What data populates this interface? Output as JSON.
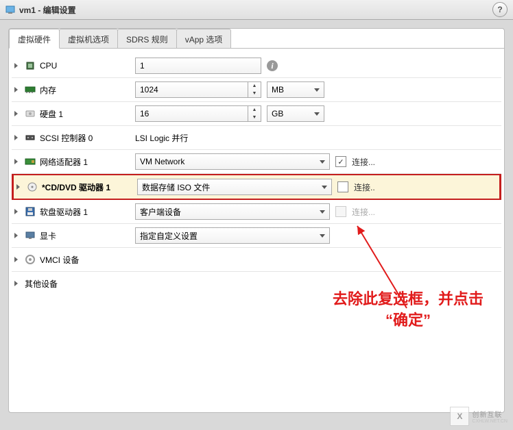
{
  "window": {
    "title": "vm1 - 编辑设置"
  },
  "tabs": {
    "hardware": "虚拟硬件",
    "options": "虚拟机选项",
    "sdrs": "SDRS 规则",
    "vapp": "vApp 选项"
  },
  "rows": {
    "cpu": {
      "label": "CPU",
      "value": "1"
    },
    "mem": {
      "label": "内存",
      "value": "1024",
      "unit": "MB"
    },
    "disk": {
      "label": "硬盘 1",
      "value": "16",
      "unit": "GB"
    },
    "scsi": {
      "label": "SCSI 控制器 0",
      "value": "LSI Logic 并行"
    },
    "net": {
      "label": "网络适配器 1",
      "value": "VM Network",
      "connect": "连接..."
    },
    "cd": {
      "label": "*CD/DVD 驱动器 1",
      "value": "数据存储 ISO 文件",
      "connect": "连接.."
    },
    "floppy": {
      "label": "软盘驱动器 1",
      "value": "客户端设备",
      "connect": "连接..."
    },
    "video": {
      "label": "显卡",
      "value": "指定自定义设置"
    },
    "vmci": {
      "label": "VMCI 设备"
    },
    "other": {
      "label": "其他设备"
    }
  },
  "annotation": {
    "line1": "去除此复选框，并点击",
    "line2": "“确定”"
  },
  "watermark": {
    "text": "创新互联",
    "sub": "CXHLW.NET.CN"
  }
}
